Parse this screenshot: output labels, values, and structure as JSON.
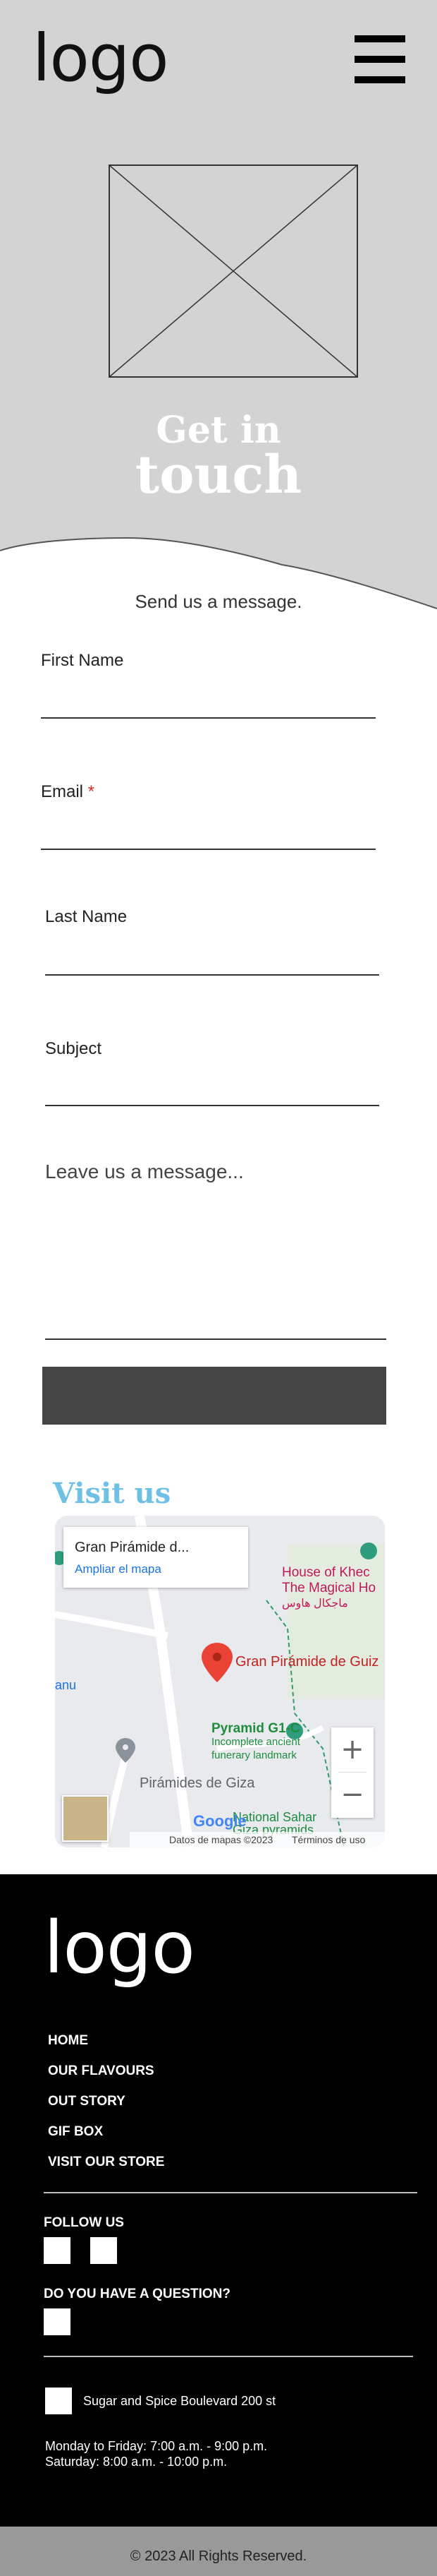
{
  "header": {
    "logo": "logo",
    "hero_title_line1": "Get in",
    "hero_title_line2": "touch"
  },
  "form": {
    "subtitle": "Send us a message.",
    "first_name_label": "First Name",
    "email_label": "Email",
    "email_required_mark": "*",
    "last_name_label": "Last Name",
    "subject_label": "Subject",
    "message_placeholder": "Leave us a message...",
    "submit_label": ""
  },
  "visit": {
    "title": "Visit us",
    "map": {
      "place_card_title": "Gran Pirámide d...",
      "place_card_link": "Ampliar el mapa",
      "poi_house_line1": "House of Khec",
      "poi_house_line2": "The Magical Ho",
      "poi_house_arabic": "ماجكال هاوس",
      "pin_label": "Gran Pirámide de Guiz",
      "pyramid_g1c": "Pyramid G1-C",
      "pyramid_g1c_sub1": "Incomplete ancient",
      "pyramid_g1c_sub2": "funerary landmark",
      "piramides": "Pirámides de Giza",
      "national_sahara_line1": "National Sahar",
      "national_sahara_line2": "Giza pyramids",
      "left_fragment": "anu",
      "zoom_in": "+",
      "zoom_out": "−",
      "google": "Google",
      "attribution": "Datos de mapas ©2023",
      "terms": "Términos de uso"
    }
  },
  "footer": {
    "logo": "logo",
    "nav": [
      "HOME",
      "OUR FLAVOURS",
      "OUT STORY",
      "GIF BOX",
      "VISIT OUR STORE"
    ],
    "follow_title": "FOLLOW US",
    "question_title": "DO YOU HAVE A QUESTION?",
    "address": "Sugar and Spice Boulevard 200 st",
    "hours_line1": "Monday to Friday: 7:00 a.m. - 9:00 p.m.",
    "hours_line2": "Saturday: 8:00 a.m. - 10:00 p.m.",
    "copyright": "© 2023  All Rights Reserved."
  },
  "colors": {
    "hero_bg": "#d3d3d3",
    "accent_blue": "#6ec1e4",
    "button_dark": "#444444",
    "footer_bg": "#000000",
    "bottom_bar": "#999999"
  }
}
